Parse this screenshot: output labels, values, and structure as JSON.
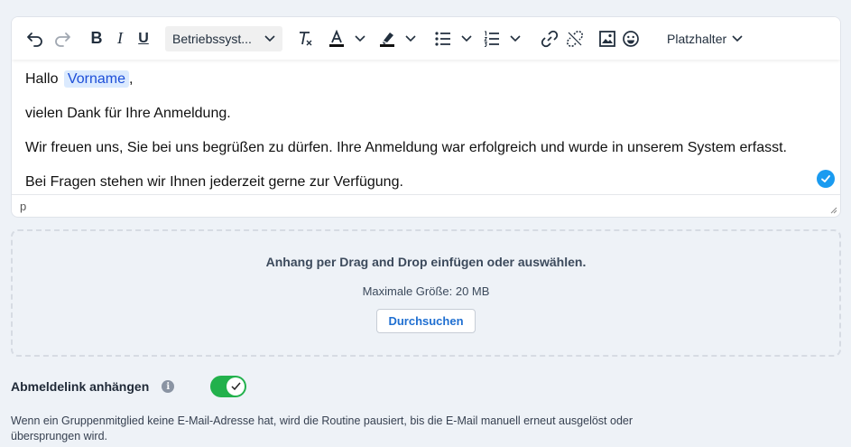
{
  "toolbar": {
    "undo_icon": "undo-icon",
    "redo_icon": "redo-icon",
    "bold_label": "B",
    "italic_label": "I",
    "underline_label": "U",
    "font_family_value": "Betriebssyst...",
    "placeholder_menu_label": "Platzhalter"
  },
  "editor": {
    "greeting_prefix": "Hallo",
    "placeholder_tag": "Vorname",
    "greeting_suffix": ",",
    "paragraphs": [
      "vielen Dank für Ihre Anmeldung.",
      "Wir freuen uns, Sie bei uns begrüßen zu dürfen. Ihre Anmeldung war erfolgreich und wurde in unserem System erfasst.",
      "Bei Fragen stehen wir Ihnen jederzeit gerne zur Verfügung."
    ],
    "status_path": "p"
  },
  "attachment": {
    "title": "Anhang per Drag and Drop einfügen oder auswählen.",
    "max_size": "Maximale Größe: 20 MB",
    "browse_label": "Durchsuchen"
  },
  "unsubscribe": {
    "label": "Abmeldelink anhängen",
    "info_glyph": "i",
    "enabled": true,
    "help_text": "Wenn ein Gruppenmitglied keine E-Mail-Adresse hat, wird die Routine pausiert, bis die E-Mail manuell erneut ausgelöst oder übersprungen wird."
  },
  "colors": {
    "toggle_on": "#22b14c",
    "tag_bg": "#dbeafe",
    "link_blue": "#1f6fd1",
    "check_badge": "#1a9bf0"
  }
}
